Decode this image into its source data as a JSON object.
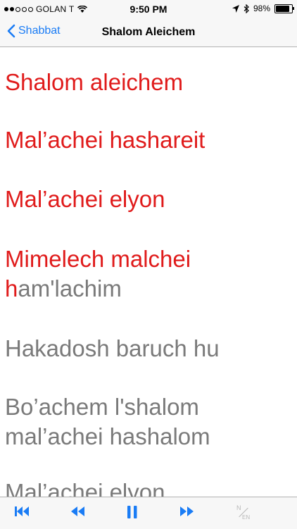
{
  "status_bar": {
    "carrier": "GOLAN T",
    "time": "9:50 PM",
    "battery": "98%"
  },
  "nav": {
    "back_label": "Shabbat",
    "title": "Shalom Aleichem"
  },
  "lyrics": [
    {
      "highlight": "Shalom aleichem",
      "rest": ""
    },
    {
      "highlight": "Mal’achei hashareit",
      "rest": ""
    },
    {
      "highlight": "Mal’achei elyon",
      "rest": ""
    },
    {
      "highlight": "Mimelech malchei\nh",
      "rest": "am'lachim"
    },
    {
      "highlight": "",
      "rest": "Hakadosh baruch hu"
    },
    {
      "highlight": "",
      "rest": "Bo’achem l'shalom\nmal’achei hashalom"
    },
    {
      "highlight": "",
      "rest": "Mal’achei elyon"
    }
  ],
  "toolbar": {
    "accent_color": "#1a7cf5",
    "lang_top": "N",
    "lang_bottom": "EN"
  },
  "colors": {
    "highlight": "#e01b1b",
    "text": "#7a7a7a"
  }
}
